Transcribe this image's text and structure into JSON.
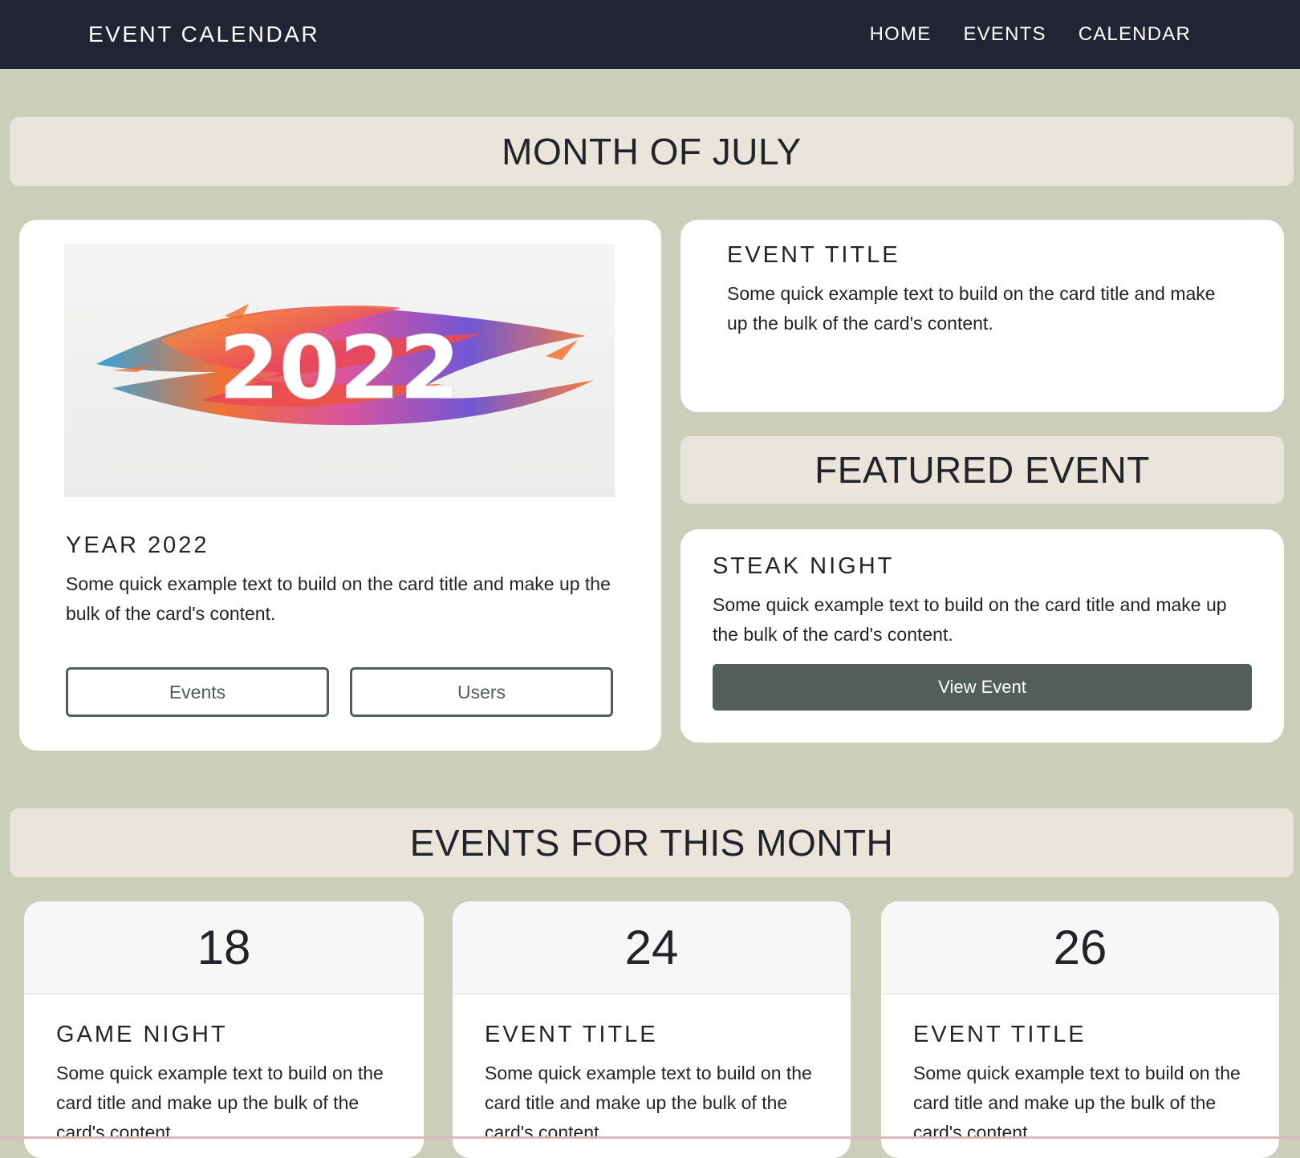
{
  "nav": {
    "brand": "EVENT CALENDAR",
    "links": [
      "HOME",
      "EVENTS",
      "CALENDAR"
    ]
  },
  "month_banner": "MONTH OF JULY",
  "hero_card": {
    "image_text": "2022",
    "title": "YEAR 2022",
    "text": "Some quick example text to build on the card title and make up the bulk of the card's content.",
    "buttons": [
      "Events",
      "Users"
    ]
  },
  "event_card": {
    "title": "EVENT TITLE",
    "text": "Some quick example text to build on the card title and make up the bulk of the card's content."
  },
  "featured_banner": "FEATURED EVENT",
  "featured_card": {
    "title": "STEAK NIGHT",
    "text": "Some quick example text to build on the card title and make up the bulk of the card's content.",
    "button": "View Event"
  },
  "events_banner": "EVENTS FOR THIS MONTH",
  "month_events": [
    {
      "day": "18",
      "title": "GAME NIGHT",
      "text": "Some quick example text to build on the card title and make up the bulk of the card's content."
    },
    {
      "day": "24",
      "title": "EVENT TITLE",
      "text": "Some quick example text to build on the card title and make up the bulk of the card's content."
    },
    {
      "day": "26",
      "title": "EVENT TITLE",
      "text": "Some quick example text to build on the card title and make up the bulk of the card's content."
    }
  ],
  "colors": {
    "navbar": "#212432",
    "page_bg": "#cbcfb9",
    "banner_bg": "#e9e5da",
    "button_dark": "#525f59"
  }
}
